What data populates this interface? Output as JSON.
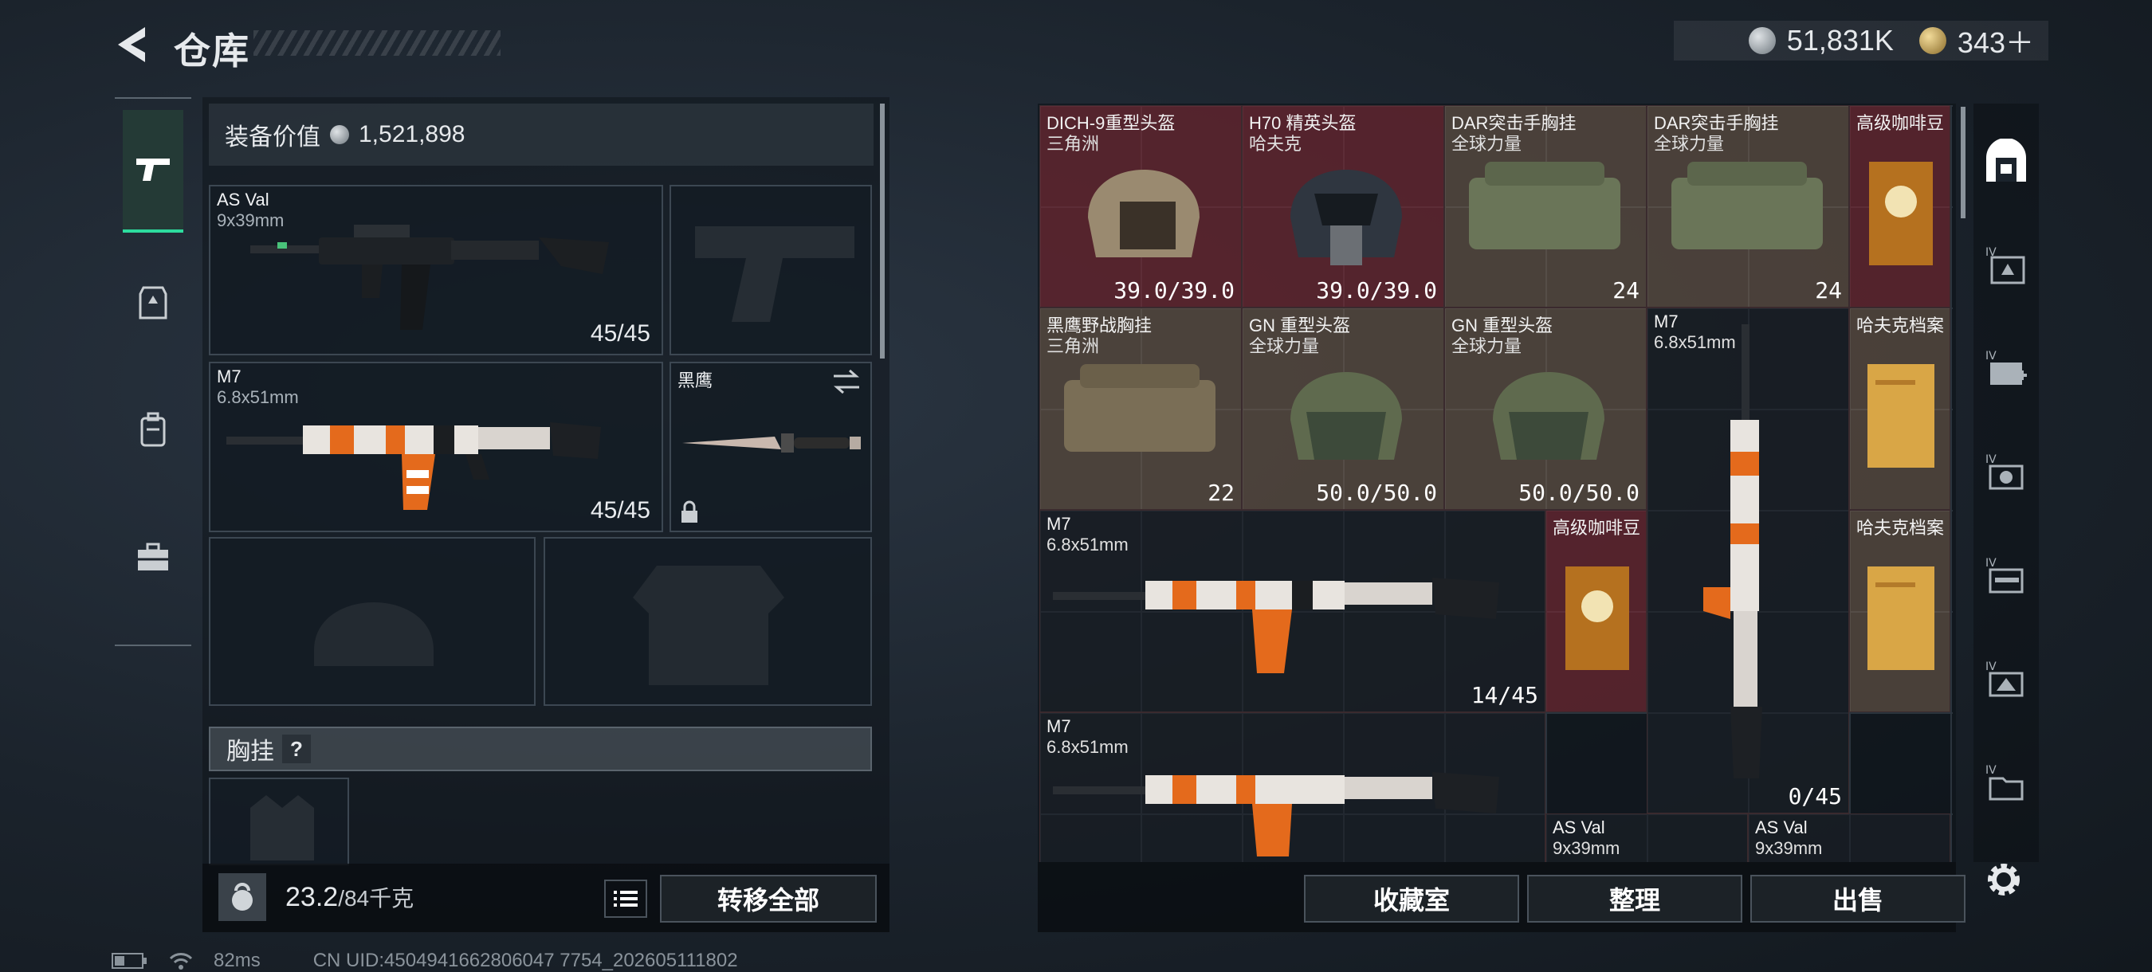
{
  "header": {
    "title": "仓库",
    "currency1": "51,831K",
    "currency2": "343＋"
  },
  "equip": {
    "value_label": "装备价值",
    "value": "1,521,898",
    "primary": {
      "name": "AS Val",
      "caliber": "9x39mm",
      "ammo": "45/45"
    },
    "secondary": {
      "name": "M7",
      "caliber": "6.8x51mm",
      "ammo": "45/45"
    },
    "melee": {
      "name": "黑鹰"
    },
    "chest_label": "胸挂",
    "chest_help": "?",
    "weight_current": "23.2",
    "weight_max": "/84千克",
    "transfer_all": "转移全部"
  },
  "stash": {
    "items": [
      {
        "name": "DICH-9重型头盔",
        "sub": "三角洲",
        "val": "39.0/39.0"
      },
      {
        "name": "H70 精英头盔",
        "sub": "哈夫克",
        "val": "39.0/39.0"
      },
      {
        "name": "DAR突击手胸挂",
        "sub": "全球力量",
        "val": "24"
      },
      {
        "name": "DAR突击手胸挂",
        "sub": "全球力量",
        "val": "24"
      },
      {
        "name": "高级咖啡豆",
        "sub": "",
        "val": ""
      },
      {
        "name": "黑鹰野战胸挂",
        "sub": "三角洲",
        "val": "22"
      },
      {
        "name": "GN 重型头盔",
        "sub": "全球力量",
        "val": "50.0/50.0"
      },
      {
        "name": "GN 重型头盔",
        "sub": "全球力量",
        "val": "50.0/50.0"
      },
      {
        "name": "M7",
        "sub": "6.8x51mm",
        "val": "0/45"
      },
      {
        "name": "哈夫克档案",
        "sub": "",
        "val": ""
      },
      {
        "name": "M7",
        "sub": "6.8x51mm",
        "val": "14/45"
      },
      {
        "name": "高级咖啡豆",
        "sub": "",
        "val": ""
      },
      {
        "name": "哈夫克档案",
        "sub": "",
        "val": ""
      },
      {
        "name": "M7",
        "sub": "6.8x51mm",
        "val": ""
      },
      {
        "name": "AS Val",
        "sub": "9x39mm",
        "val": ""
      },
      {
        "name": "AS Val",
        "sub": "9x39mm",
        "val": ""
      }
    ],
    "btn_collection": "收藏室",
    "btn_sort": "整理",
    "btn_sell": "出售"
  },
  "footer": {
    "ping": "82ms",
    "uid": "CN UID:4504941662806047 7754_202605111802"
  },
  "colors": {
    "accent": "#2ddc9e",
    "rare_red": "#7a2a34",
    "tan": "#786250"
  }
}
